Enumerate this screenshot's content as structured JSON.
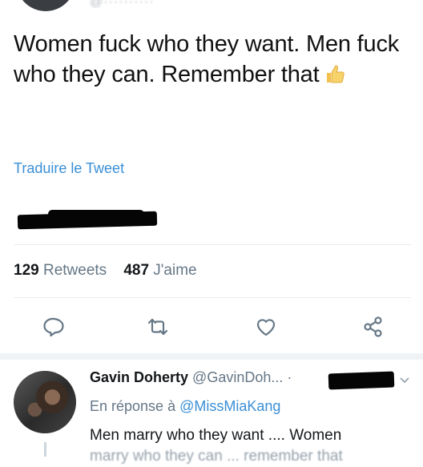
{
  "tweet": {
    "text": "Women fuck who they want. Men fuck who they can. Remember that",
    "translate_label": "Traduire le Tweet",
    "retweets_count": "129",
    "retweets_label": "Retweets",
    "likes_count": "487",
    "likes_label": "J'aime"
  },
  "reply": {
    "name": "Gavin Doherty",
    "handle": "@GavinDoh...",
    "separator": "·",
    "reply_prefix": "En réponse à",
    "reply_to": "@MissMiaKang",
    "text_line1": "Men marry who they want .... Women",
    "text_line2": "marry who they can ... remember that"
  },
  "icons": {
    "reply": "reply-icon",
    "retweet": "retweet-icon",
    "like": "heart-icon",
    "share": "share-icon",
    "thumb": "thumbs-up-icon",
    "chevron": "chevron-down-icon"
  },
  "colors": {
    "link": "#3a8fd6",
    "muted": "#657786",
    "divider": "#e6ecf0"
  }
}
